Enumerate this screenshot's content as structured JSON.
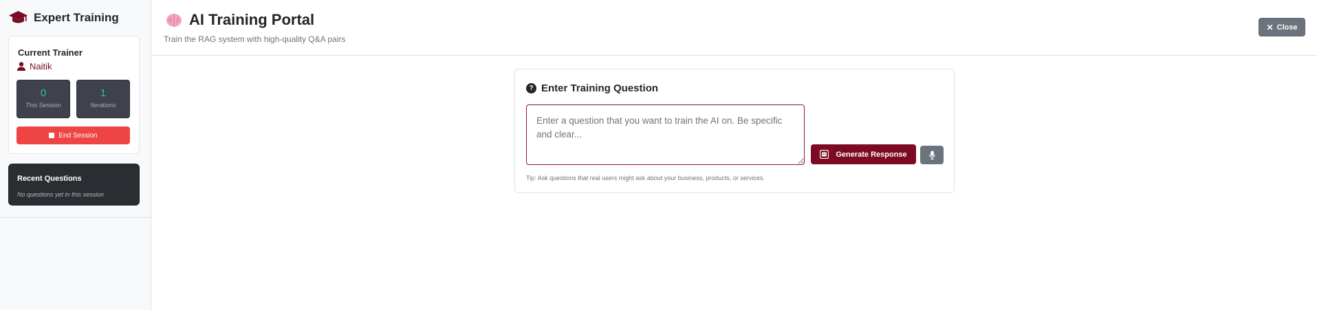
{
  "sidebar": {
    "brand_title": "Expert Training",
    "trainer": {
      "heading": "Current Trainer",
      "name": "Naitik"
    },
    "stats": [
      {
        "value": "0",
        "label": "This Session"
      },
      {
        "value": "1",
        "label": "Iterations"
      }
    ],
    "end_session_label": "End Session",
    "recent": {
      "heading": "Recent Questions",
      "empty_text": "No questions yet in this session"
    }
  },
  "header": {
    "title": "AI Training Portal",
    "subtitle": "Train the RAG system with high-quality Q&A pairs",
    "close_label": "Close"
  },
  "question_card": {
    "title": "Enter Training Question",
    "input_value": "",
    "input_placeholder": "Enter a question that you want to train the AI on. Be specific and clear...",
    "generate_label": "Generate Response",
    "tip": "Tip: Ask questions that real users might ask about your business, products, or services."
  },
  "colors": {
    "brand": "#7b0a22",
    "danger": "#ef4444",
    "secondary": "#6c737d",
    "stat_value": "#20c997"
  },
  "icons": {
    "brand": "graduation-cap-icon",
    "trainer": "user-icon",
    "end_session": "stop-icon",
    "header": "brain-icon",
    "close": "close-icon",
    "card": "question-circle-icon",
    "generate": "robot-icon",
    "mic": "microphone-icon"
  }
}
